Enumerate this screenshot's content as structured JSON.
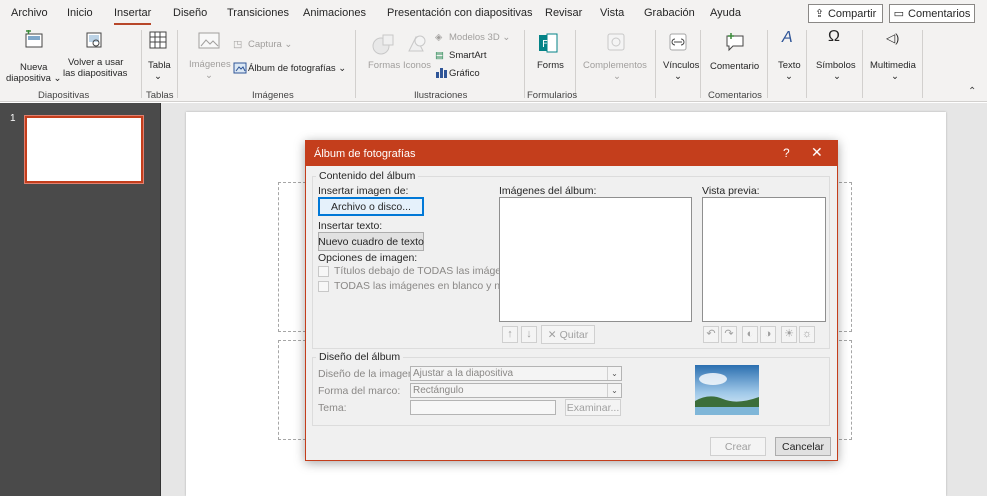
{
  "tabs": [
    "Archivo",
    "Inicio",
    "Insertar",
    "Diseño",
    "Transiciones",
    "Animaciones",
    "Presentación con diapositivas",
    "Revisar",
    "Vista",
    "Grabación",
    "Ayuda"
  ],
  "active_tab": "Insertar",
  "share_label": "Compartir",
  "comments_label": "Comentarios",
  "ribbon": {
    "new_slide": [
      "Nueva",
      "diapositiva ⌄"
    ],
    "reuse_slides": [
      "Volver a usar",
      "las diapositivas"
    ],
    "table": "Tabla",
    "images": "Imágenes",
    "capture": "Captura ⌄",
    "photo_album": "Álbum de fotografías ⌄",
    "shapes": "Formas",
    "icons": "Iconos",
    "models3d": "Modelos 3D ⌄",
    "smartart": "SmartArt",
    "chart": "Gráfico",
    "forms": "Forms",
    "addins": "Complementos",
    "links": "Vínculos",
    "comment": "Comentario",
    "text": "Texto",
    "symbols": "Símbolos",
    "media": "Multimedia",
    "groups": {
      "slides": "Diapositivas",
      "tables": "Tablas",
      "images": "Imágenes",
      "illustrations": "Ilustraciones",
      "forms": "Formularios",
      "comments": "Comentarios"
    }
  },
  "slide_number": "1",
  "dialog": {
    "title": "Álbum de fotografías",
    "help": "?",
    "close": "✕",
    "album_contents": "Contenido del álbum",
    "insert_image_from": "Insertar imagen de:",
    "file_or_disk": "Archivo o disco...",
    "insert_text": "Insertar texto:",
    "new_text_box": "Nuevo cuadro de texto",
    "image_options": "Opciones de imagen:",
    "captions_option": "Títulos debajo de TODAS las imágenes",
    "bw_option": "TODAS las imágenes en blanco y negro",
    "album_images": "Imágenes del álbum:",
    "preview": "Vista previa:",
    "remove": "Quitar",
    "album_layout": "Diseño del álbum",
    "picture_layout_label": "Diseño de la imagen:",
    "picture_layout_value": "Ajustar a la diapositiva",
    "frame_shape_label": "Forma del marco:",
    "frame_shape_value": "Rectángulo",
    "theme_label": "Tema:",
    "theme_value": "",
    "browse": "Examinar...",
    "create": "Crear",
    "cancel": "Cancelar"
  },
  "colors": {
    "accent": "#c43e1c",
    "ribbon_bg": "#f3f2f1",
    "pane_bg": "#4a4a4a",
    "dialog_bg": "#f0f0f0"
  }
}
